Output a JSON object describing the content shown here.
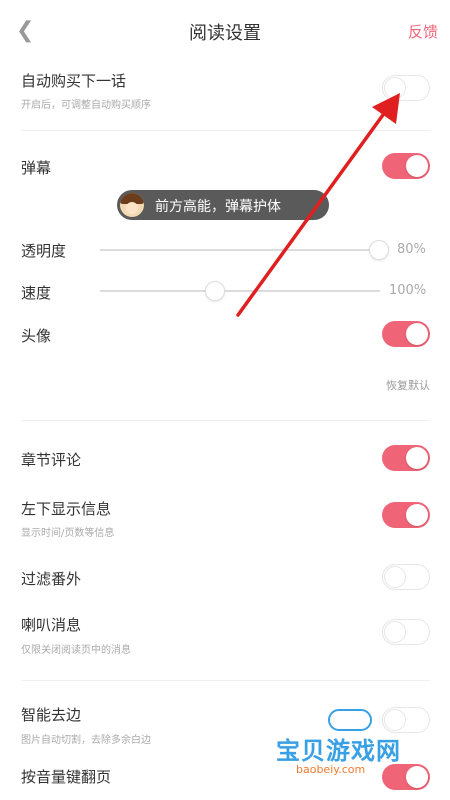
{
  "header": {
    "back_icon": "chevron-left-icon",
    "title": "阅读设置",
    "feedback": "反馈"
  },
  "colors": {
    "accent": "#f06478",
    "toggle_off_border": "#e6e6e6",
    "annotation_arrow": "#e02020"
  },
  "settings": {
    "auto_buy": {
      "label": "自动购买下一话",
      "desc": "开启后，可调整自动购买顺序",
      "on": false
    },
    "danmaku": {
      "label": "弹幕",
      "on": true,
      "preview": "前方高能，弹幕护体"
    },
    "opacity": {
      "label": "透明度",
      "value_text": "80%",
      "value": 0.8
    },
    "speed": {
      "label": "速度",
      "value_text": "100%",
      "value": 0.39
    },
    "avatar": {
      "label": "头像",
      "on": true
    },
    "restore_default": "恢复默认",
    "chapter_comments": {
      "label": "章节评论",
      "on": true
    },
    "info_bottom_left": {
      "label": "左下显示信息",
      "desc": "显示时间/页数等信息",
      "on": true
    },
    "filter_extras": {
      "label": "过滤番外",
      "on": false
    },
    "horn_messages": {
      "label": "喇叭消息",
      "desc": "仅限关闭阅读页中的消息",
      "on": false
    },
    "smart_crop": {
      "label": "智能去边",
      "desc": "图片自动切割，去除多余白边",
      "on": false
    },
    "volume_key_page": {
      "label": "按音量键翻页",
      "on": true
    }
  },
  "watermark": {
    "text": "宝贝游戏网",
    "sub": "baobeiy.com"
  }
}
